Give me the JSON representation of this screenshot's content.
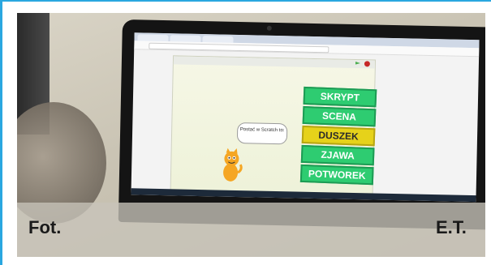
{
  "photo": {
    "caption_left": "Fot.",
    "caption_right": "E.T."
  },
  "scratch_screen": {
    "menu": [
      "SKRYPT",
      "SCENA",
      "DUSZEK",
      "ZJAWA",
      "POTWOREK"
    ],
    "selected_index": 2,
    "speech_bubble": "Postać w Scratch to:"
  },
  "colors": {
    "frame_border": "#2aa7e0",
    "button_green": "#2ecc71",
    "button_selected": "#e6d21a"
  }
}
